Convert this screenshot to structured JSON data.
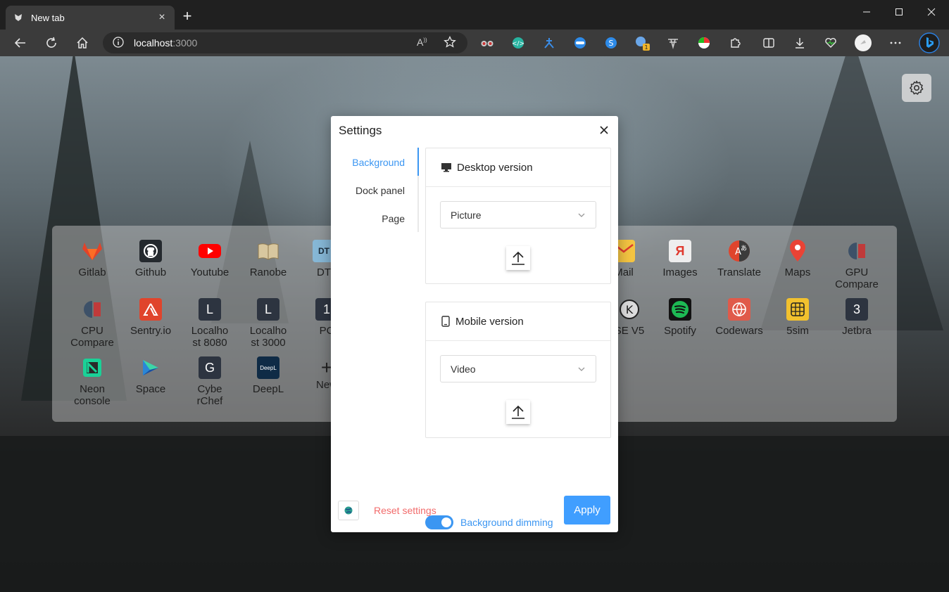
{
  "browser": {
    "tab": {
      "title": "New tab"
    },
    "address": {
      "host": "localhost",
      "port": ":3000"
    },
    "extension_badge": "1"
  },
  "dock": {
    "apps": [
      {
        "label": "Gitlab",
        "icon": "gitlab-icon",
        "color": "#e24329",
        "glyph": ""
      },
      {
        "label": "Github",
        "icon": "github-icon",
        "color": "#24292e",
        "glyph": ""
      },
      {
        "label": "Youtube",
        "icon": "youtube-icon",
        "color": "#ff0000",
        "glyph": "▶"
      },
      {
        "label": "Ranobe",
        "icon": "book-icon",
        "color": "#c9b58c",
        "glyph": ""
      },
      {
        "label": "DT",
        "icon": "dt-icon",
        "color": "#86b7d6",
        "glyph": "DT"
      },
      {
        "label": "Mail",
        "icon": "mail-icon",
        "color": "#f5c542",
        "glyph": ""
      },
      {
        "label": "Images",
        "icon": "yandex-images-icon",
        "color": "#eeeeee",
        "glyph": "Я"
      },
      {
        "label": "Translate",
        "icon": "translate-icon",
        "color": "#3b3b3b",
        "glyph": "A"
      },
      {
        "label": "Maps",
        "icon": "map-pin-icon",
        "color": "#ea4335",
        "glyph": ""
      },
      {
        "label": "GPU Compare",
        "icon": "gpu-compare-icon",
        "color": "#c03a3a",
        "glyph": ""
      },
      {
        "label": "CPU Compare",
        "icon": "cpu-compare-icon",
        "color": "#c03a3a",
        "glyph": ""
      },
      {
        "label": "Sentry.io",
        "icon": "sentry-icon",
        "color": "#e0442c",
        "glyph": ""
      },
      {
        "label": "Localhost 8080",
        "icon": "letter-l-icon",
        "color": "#2d3440",
        "glyph": "L"
      },
      {
        "label": "Localhost 3000",
        "icon": "letter-l-icon",
        "color": "#2d3440",
        "glyph": "L"
      },
      {
        "label": "PC",
        "icon": "letter-1-icon",
        "color": "#2d3440",
        "glyph": "1"
      },
      {
        "label": "SE V5",
        "icon": "k-circle-icon",
        "color": "#222222",
        "glyph": "K"
      },
      {
        "label": "Spotify",
        "icon": "spotify-icon",
        "color": "#1db954",
        "glyph": ""
      },
      {
        "label": "Codewars",
        "icon": "codewars-icon",
        "color": "#e05a4a",
        "glyph": ""
      },
      {
        "label": "5sim",
        "icon": "sim-card-icon",
        "color": "#f2c12e",
        "glyph": ""
      },
      {
        "label": "Jetbra",
        "icon": "letter-3-icon",
        "color": "#2d3440",
        "glyph": "3"
      },
      {
        "label": "Neon console",
        "icon": "neon-icon",
        "color": "#1ad197",
        "glyph": "N"
      },
      {
        "label": "Space",
        "icon": "space-icon",
        "color": "#2b86d6",
        "glyph": ""
      },
      {
        "label": "CyberChef",
        "icon": "letter-g-icon",
        "color": "#2d3440",
        "glyph": "G"
      },
      {
        "label": "DeepL",
        "icon": "deepl-icon",
        "color": "#0f2b46",
        "glyph": ""
      },
      {
        "label": "New",
        "icon": "plus-icon",
        "color": "#333333",
        "glyph": "+"
      }
    ],
    "visible_labels": [
      "Gitlab",
      "Github",
      "Youtube",
      "Ranobe",
      "DT",
      "Mail",
      "Images",
      "Translate",
      "Maps",
      "GPU\nCompare",
      "CPU\nCompare",
      "Sentry.io",
      "Localho\nst 8080",
      "Localho\nst 3000",
      "PC",
      "SE V5",
      "Spotify",
      "Codewars",
      "5sim",
      "Jetbra",
      "Neon\nconsole",
      "Space",
      "Cybe\nrChef",
      "DeepL",
      "New"
    ]
  },
  "settings": {
    "title": "Settings",
    "tabs": [
      "Background",
      "Dock panel",
      "Page"
    ],
    "active_tab": "Background",
    "desktop": {
      "header": "Desktop version",
      "select_value": "Picture"
    },
    "mobile": {
      "header": "Mobile version",
      "select_value": "Video"
    },
    "dimming": {
      "label": "Background dimming",
      "enabled": true
    },
    "reset_label": "Reset settings",
    "apply_label": "Apply"
  },
  "colors": {
    "accent": "#3b96f2",
    "danger": "#f26b6b",
    "apply": "#409eff"
  }
}
